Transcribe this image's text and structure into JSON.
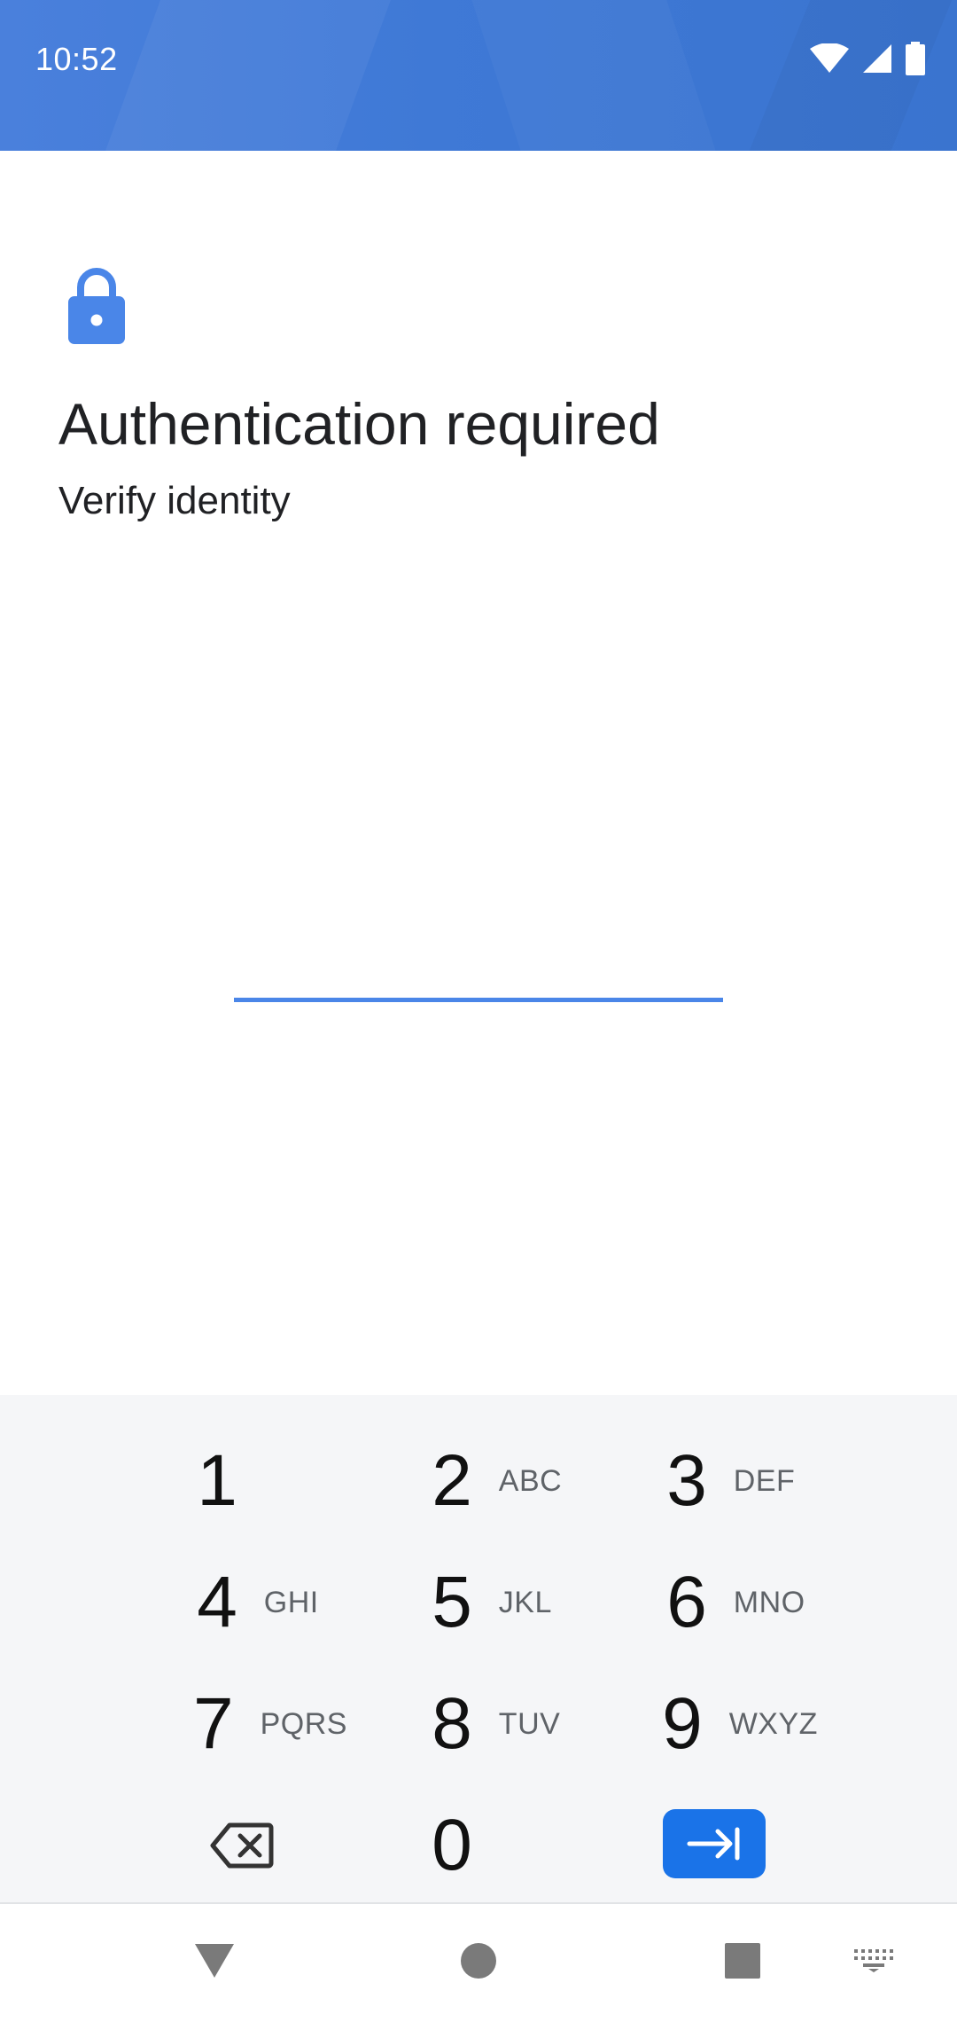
{
  "status_bar": {
    "time": "10:52",
    "icons": [
      "wifi-icon",
      "cellular-signal-icon",
      "battery-icon"
    ],
    "background_color": "#4a80dc"
  },
  "auth": {
    "icon": "lock-icon",
    "title": "Authentication required",
    "subtitle": "Verify identity",
    "accent_color": "#4a86e8"
  },
  "pin_input": {
    "value": ""
  },
  "keypad": {
    "keys": [
      {
        "digit": "1",
        "letters": ""
      },
      {
        "digit": "2",
        "letters": "ABC"
      },
      {
        "digit": "3",
        "letters": "DEF"
      },
      {
        "digit": "4",
        "letters": "GHI"
      },
      {
        "digit": "5",
        "letters": "JKL"
      },
      {
        "digit": "6",
        "letters": "MNO"
      },
      {
        "digit": "7",
        "letters": "PQRS"
      },
      {
        "digit": "8",
        "letters": "TUV"
      },
      {
        "digit": "9",
        "letters": "WXYZ"
      },
      {
        "digit": "0",
        "letters": ""
      }
    ],
    "delete_icon": "backspace-icon",
    "enter_icon": "enter-arrow-icon",
    "enter_color": "#1a73e8"
  },
  "nav_bar": {
    "icons": [
      "back-icon",
      "home-icon",
      "recents-icon",
      "keyboard-switch-icon"
    ]
  }
}
